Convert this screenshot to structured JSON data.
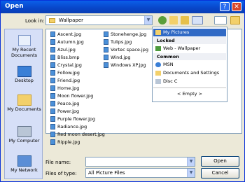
{
  "window": {
    "title": "Open"
  },
  "look_in": {
    "label": "Look in:",
    "value": "Wallpaper"
  },
  "places": [
    {
      "label": "My Recent Documents"
    },
    {
      "label": "Desktop"
    },
    {
      "label": "My Documents"
    },
    {
      "label": "My Computer"
    },
    {
      "label": "My Network"
    }
  ],
  "files_col1": [
    "Ascent.jpg",
    "Autumn.jpg",
    "Azul.jpg",
    "Bliss.bmp",
    "Crystal.jpg",
    "Follow.jpg",
    "Friend.jpg",
    "Home.jpg",
    "Moon flower.jpg",
    "Peace.jpg",
    "Power.jpg",
    "Purple flower.jpg",
    "Radiance.jpg",
    "Red moon desert.jpg",
    "Ripple.jpg"
  ],
  "files_col2": [
    "Stonehenge.jpg",
    "Tulips.jpg",
    "Vortec space.jpg",
    "Wind.jpg",
    "Windows XP.jpg"
  ],
  "dropdown": {
    "selected": "My Pictures",
    "locked_header": "Locked",
    "locked_item": "Web - Wallpaper",
    "common_header": "Common",
    "common_items": [
      "MSN",
      "Documents and Settings",
      "Disc C"
    ],
    "empty": "< Empty >"
  },
  "file_name": {
    "label": "File name:",
    "value": ""
  },
  "file_type": {
    "label": "Files of type:",
    "value": "All Picture Files"
  },
  "buttons": {
    "open": "Open",
    "cancel": "Cancel"
  },
  "icons": {
    "help": "?",
    "close": "✕"
  }
}
